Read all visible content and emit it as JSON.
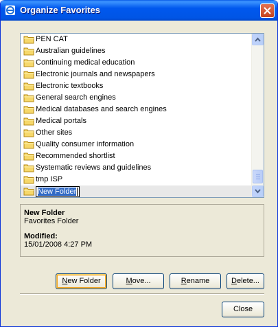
{
  "window": {
    "title": "Organize Favorites",
    "title_icon": "ie-icon",
    "accent_color": "#0055e5"
  },
  "list": {
    "items": [
      {
        "label": "PEN CAT"
      },
      {
        "label": "Australian guidelines"
      },
      {
        "label": "Continuing medical education"
      },
      {
        "label": "Electronic journals and newspapers"
      },
      {
        "label": "Electronic textbooks"
      },
      {
        "label": "General search engines"
      },
      {
        "label": "Medical databases and search engines"
      },
      {
        "label": "Medical portals"
      },
      {
        "label": "Other sites"
      },
      {
        "label": "Quality consumer information"
      },
      {
        "label": "Recommended shortlist"
      },
      {
        "label": "Systematic reviews and guidelines"
      },
      {
        "label": "tmp ISP"
      }
    ],
    "editing_item": {
      "label": "New Folder"
    }
  },
  "info": {
    "name": "New Folder",
    "type": "Favorites Folder",
    "modified_label": "Modified:",
    "modified_value": "15/01/2008 4:27 PM"
  },
  "buttons": {
    "new_folder": {
      "mnemonic": "N",
      "rest": "ew Folder"
    },
    "move": {
      "mnemonic": "M",
      "rest": "ove..."
    },
    "rename": {
      "mnemonic": "R",
      "rest": "ename"
    },
    "delete": {
      "mnemonic": "D",
      "rest": "elete..."
    },
    "close": "Close"
  }
}
